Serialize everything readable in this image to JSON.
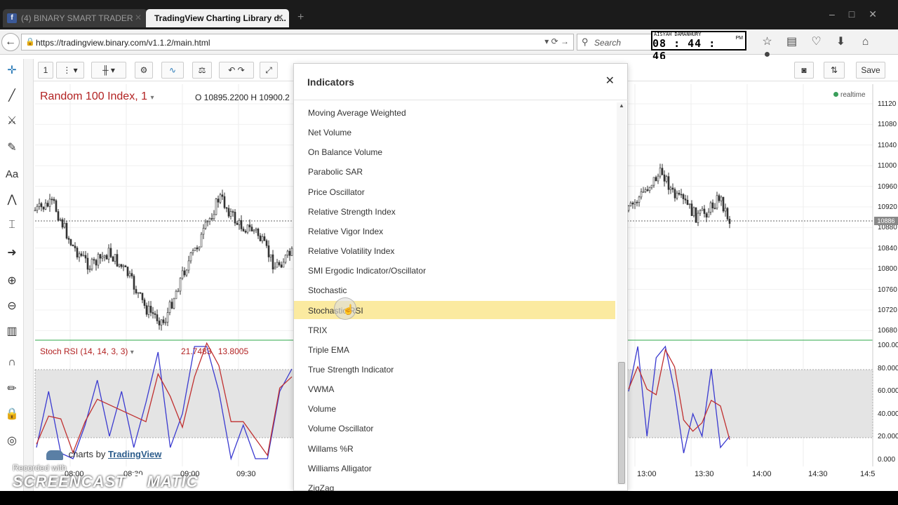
{
  "browser": {
    "tabs": [
      {
        "label": "(4) BINARY SMART TRADER",
        "favicon": "f"
      },
      {
        "label": "TradingView Charting Library d..."
      }
    ],
    "url": "https://tradingview.binary.com/v1.1.2/main.html",
    "search_placeholder": "Search",
    "clock": {
      "name": "AISYAH DAMANHURY",
      "time": "08 : 44 : 46",
      "ampm": "PM"
    }
  },
  "toolbar": {
    "interval": "1",
    "save_label": "Save"
  },
  "chart": {
    "symbol": "Random 100 Index, 1",
    "ohlc_text": "O  10895.2200  H  10900.2",
    "realtime_label": "realtime",
    "current_price": "10886",
    "price_ticks": [
      "11120",
      "11080",
      "11040",
      "11000",
      "10960",
      "10920",
      "10880",
      "10840",
      "10800",
      "10760",
      "10720",
      "10680"
    ],
    "osc_ticks": [
      "100.00",
      "80.000",
      "60.000",
      "40.000",
      "20.000",
      "0.000"
    ],
    "time_ticks": [
      {
        "label": "08:00"
      },
      {
        "label": "08:30"
      },
      {
        "label": "09:00"
      },
      {
        "label": "09:30"
      },
      {
        "label": "13:00"
      },
      {
        "label": "13:30"
      },
      {
        "label": "14:00"
      },
      {
        "label": "14:30"
      },
      {
        "label": "14:5"
      }
    ],
    "oscillator": {
      "label": "Stoch RSI (14, 14, 3, 3)",
      "value_k": "21.7483",
      "value_d": "13.8005"
    },
    "watermark_prefix": "charts by",
    "watermark_brand": "TradingView"
  },
  "overlay": {
    "recorded_with": "Recorded with",
    "brand": "SCREENCAST",
    "brand_suffix": "MATIC"
  },
  "dialog": {
    "title": "Indicators",
    "highlighted_index": 10,
    "items": [
      "Moving Average Weighted",
      "Net Volume",
      "On Balance Volume",
      "Parabolic SAR",
      "Price Oscillator",
      "Relative Strength Index",
      "Relative Vigor Index",
      "Relative Volatility Index",
      "SMI Ergodic Indicator/Oscillator",
      "Stochastic",
      "Stochastic RSI",
      "TRIX",
      "Triple EMA",
      "True Strength Indicator",
      "VWMA",
      "Volume",
      "Volume Oscillator",
      "Willams %R",
      "Williams Alligator",
      "ZigZag"
    ]
  },
  "icons": {
    "facebook": "facebook-icon",
    "lock": "lock-icon",
    "reload": "reload-icon",
    "star": "star-icon",
    "home": "home-icon",
    "download": "download-icon"
  }
}
